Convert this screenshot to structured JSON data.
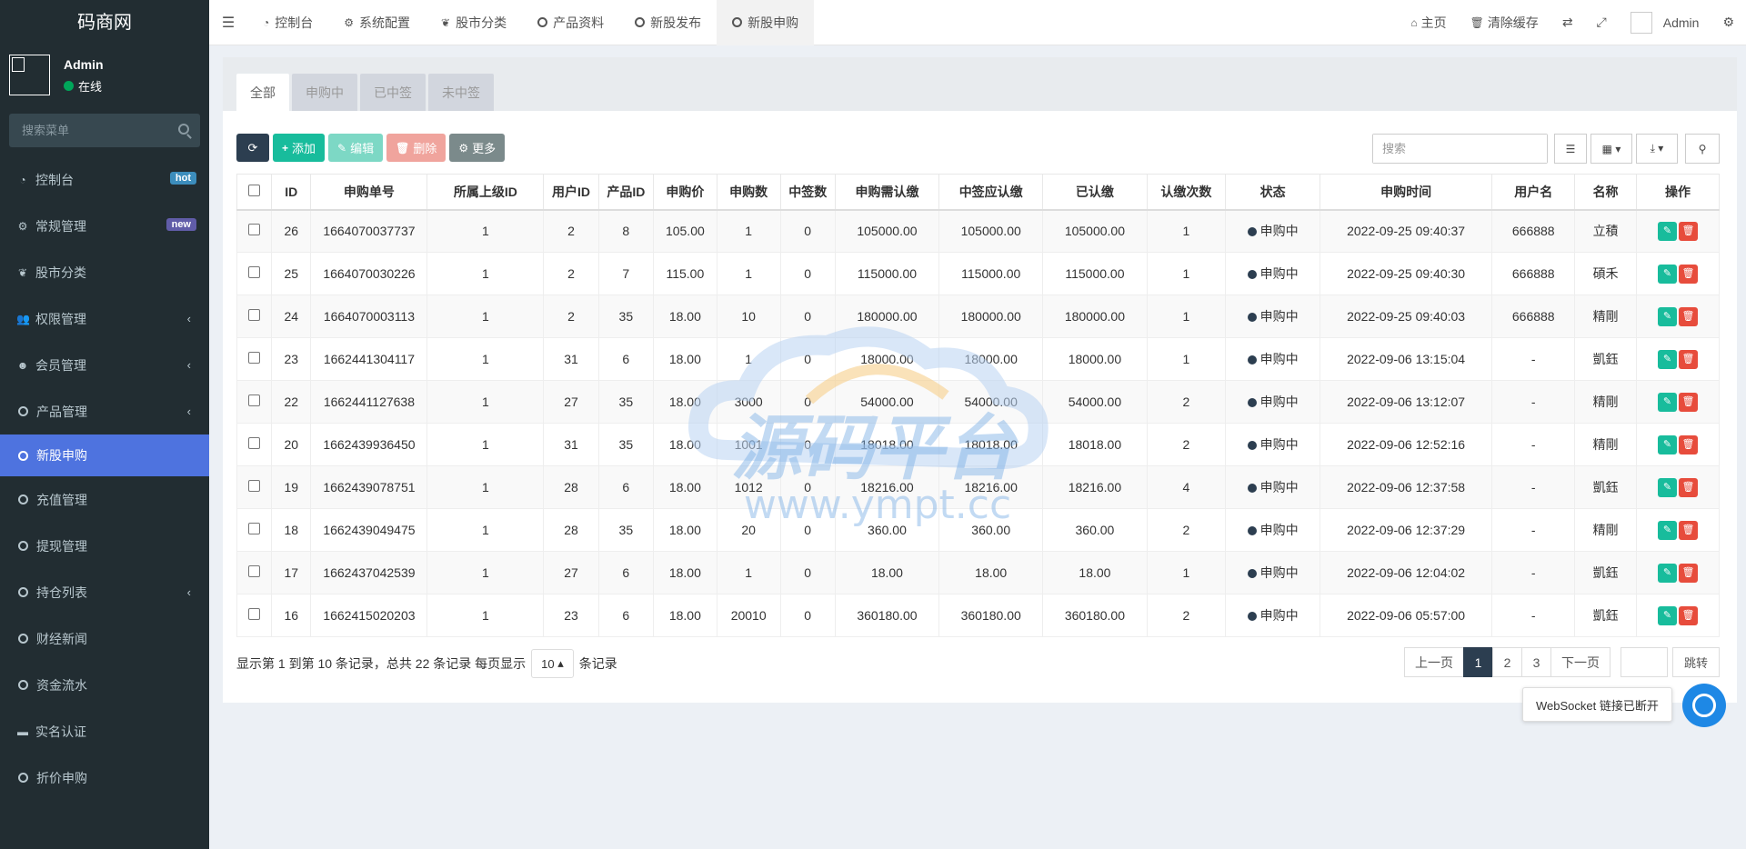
{
  "app": {
    "logo": "码商网"
  },
  "user": {
    "name": "Admin",
    "status": "在线"
  },
  "sidebar": {
    "search_placeholder": "搜索菜单",
    "items": [
      {
        "label": "控制台",
        "icon": "dashboard-icon",
        "badge": "hot",
        "badge_color": "#3c8dbc"
      },
      {
        "label": "常规管理",
        "icon": "cogs-icon",
        "badge": "new",
        "badge_color": "#605ca8"
      },
      {
        "label": "股市分类",
        "icon": "leaf-icon"
      },
      {
        "label": "权限管理",
        "icon": "users-icon",
        "chevron": "‹"
      },
      {
        "label": "会员管理",
        "icon": "user-circle-icon",
        "chevron": "‹"
      },
      {
        "label": "产品管理",
        "icon": "circle-icon",
        "chevron": "‹"
      },
      {
        "label": "新股申购",
        "icon": "circle-icon",
        "active": true
      },
      {
        "label": "充值管理",
        "icon": "circle-icon"
      },
      {
        "label": "提现管理",
        "icon": "circle-icon"
      },
      {
        "label": "持仓列表",
        "icon": "circle-icon",
        "chevron": "‹"
      },
      {
        "label": "财经新闻",
        "icon": "circle-icon"
      },
      {
        "label": "资金流水",
        "icon": "circle-icon"
      },
      {
        "label": "实名认证",
        "icon": "id-card-icon"
      },
      {
        "label": "折价申购",
        "icon": "circle-icon"
      }
    ]
  },
  "header": {
    "tabs": [
      {
        "label": "控制台",
        "icon": "dashboard-icon"
      },
      {
        "label": "系统配置",
        "icon": "gear-icon"
      },
      {
        "label": "股市分类",
        "icon": "leaf-icon"
      },
      {
        "label": "产品资料",
        "icon": "circle-icon"
      },
      {
        "label": "新股发布",
        "icon": "circle-icon"
      },
      {
        "label": "新股申购",
        "icon": "circle-icon",
        "active": true
      }
    ],
    "home": "主页",
    "clear_cache": "清除缓存",
    "admin": "Admin"
  },
  "content_tabs": [
    "全部",
    "申购中",
    "已中签",
    "未中签"
  ],
  "toolbar": {
    "add": "添加",
    "edit": "编辑",
    "delete": "删除",
    "more": "更多"
  },
  "search": {
    "placeholder": "搜索"
  },
  "table": {
    "columns": [
      "",
      "ID",
      "申购单号",
      "所属上级ID",
      "用户ID",
      "产品ID",
      "申购价",
      "申购数",
      "中签数",
      "申购需认缴",
      "中签应认缴",
      "已认缴",
      "认缴次数",
      "状态",
      "申购时间",
      "用户名",
      "名称",
      "操作"
    ],
    "rows": [
      [
        "26",
        "1664070037737",
        "1",
        "2",
        "8",
        "105.00",
        "1",
        "0",
        "105000.00",
        "105000.00",
        "105000.00",
        "1",
        "申购中",
        "2022-09-25 09:40:37",
        "666888",
        "立積"
      ],
      [
        "25",
        "1664070030226",
        "1",
        "2",
        "7",
        "115.00",
        "1",
        "0",
        "115000.00",
        "115000.00",
        "115000.00",
        "1",
        "申购中",
        "2022-09-25 09:40:30",
        "666888",
        "碩禾"
      ],
      [
        "24",
        "1664070003113",
        "1",
        "2",
        "35",
        "18.00",
        "10",
        "0",
        "180000.00",
        "180000.00",
        "180000.00",
        "1",
        "申购中",
        "2022-09-25 09:40:03",
        "666888",
        "精剛"
      ],
      [
        "23",
        "1662441304117",
        "1",
        "31",
        "6",
        "18.00",
        "1",
        "0",
        "18000.00",
        "18000.00",
        "18000.00",
        "1",
        "申购中",
        "2022-09-06 13:15:04",
        "-",
        "凱鈺"
      ],
      [
        "22",
        "1662441127638",
        "1",
        "27",
        "35",
        "18.00",
        "3000",
        "0",
        "54000.00",
        "54000.00",
        "54000.00",
        "2",
        "申购中",
        "2022-09-06 13:12:07",
        "-",
        "精剛"
      ],
      [
        "20",
        "1662439936450",
        "1",
        "31",
        "35",
        "18.00",
        "1001",
        "0",
        "18018.00",
        "18018.00",
        "18018.00",
        "2",
        "申购中",
        "2022-09-06 12:52:16",
        "-",
        "精剛"
      ],
      [
        "19",
        "1662439078751",
        "1",
        "28",
        "6",
        "18.00",
        "1012",
        "0",
        "18216.00",
        "18216.00",
        "18216.00",
        "4",
        "申购中",
        "2022-09-06 12:37:58",
        "-",
        "凱鈺"
      ],
      [
        "18",
        "1662439049475",
        "1",
        "28",
        "35",
        "18.00",
        "20",
        "0",
        "360.00",
        "360.00",
        "360.00",
        "2",
        "申购中",
        "2022-09-06 12:37:29",
        "-",
        "精剛"
      ],
      [
        "17",
        "1662437042539",
        "1",
        "27",
        "6",
        "18.00",
        "1",
        "0",
        "18.00",
        "18.00",
        "18.00",
        "1",
        "申购中",
        "2022-09-06 12:04:02",
        "-",
        "凱鈺"
      ],
      [
        "16",
        "1662415020203",
        "1",
        "23",
        "6",
        "18.00",
        "20010",
        "0",
        "360180.00",
        "360180.00",
        "360180.00",
        "2",
        "申购中",
        "2022-09-06 05:57:00",
        "-",
        "凱鈺"
      ]
    ]
  },
  "pagination": {
    "info": "显示第 1 到第 10 条记录，总共 22 条记录 每页显示",
    "page_size": "10",
    "suffix": "条记录",
    "prev": "上一页",
    "pages": [
      "1",
      "2",
      "3"
    ],
    "next": "下一页",
    "jump": "跳转"
  },
  "websocket": {
    "message": "WebSocket 链接已断开"
  },
  "watermark": {
    "text": "源码平台",
    "url": "www.ympt.cc"
  }
}
